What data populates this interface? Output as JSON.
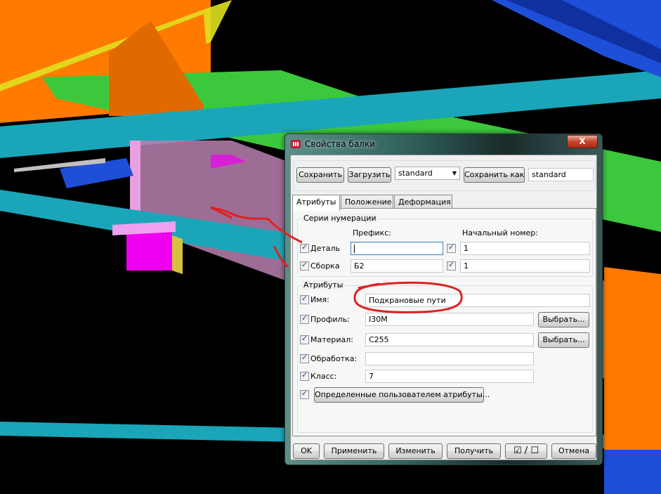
{
  "window": {
    "title": "Свойства балки",
    "close": "X"
  },
  "toolbar": {
    "save": "Сохранить",
    "load": "Загрузить",
    "preset_value": "standard",
    "save_as": "Сохранить как",
    "save_as_value": "standard"
  },
  "tabs": [
    "Атрибуты",
    "Положение",
    "Деформация"
  ],
  "numbering": {
    "title": "Серии нумерации",
    "prefix_header": "Префикс:",
    "start_header": "Начальный номер:",
    "rows": [
      {
        "label": "Деталь",
        "prefix": "",
        "start": "1"
      },
      {
        "label": "Сборка",
        "prefix": "Б2",
        "start": "1"
      }
    ]
  },
  "attributes": {
    "title": "Атрибуты",
    "name": {
      "label": "Имя:",
      "value": "Подкрановые пути"
    },
    "profile": {
      "label": "Профиль:",
      "value": "I30M",
      "button": "Выбрать..."
    },
    "material": {
      "label": "Материал:",
      "value": "C255",
      "button": "Выбрать..."
    },
    "finish": {
      "label": "Обработка:",
      "value": ""
    },
    "class": {
      "label": "Класс:",
      "value": "7"
    },
    "user_attrs": "Определенные пользователем атрибуты..."
  },
  "footer": {
    "ok": "OK",
    "apply": "Применить",
    "modify": "Изменить",
    "get": "Получить",
    "toggle": "☑ / ☐",
    "cancel": "Отмена"
  },
  "colors": {
    "annotation": "#e02020",
    "orange": "#ff7a00",
    "cyan": "#1aa6b8",
    "green": "#3cc83c",
    "blue": "#1f4fd8"
  }
}
